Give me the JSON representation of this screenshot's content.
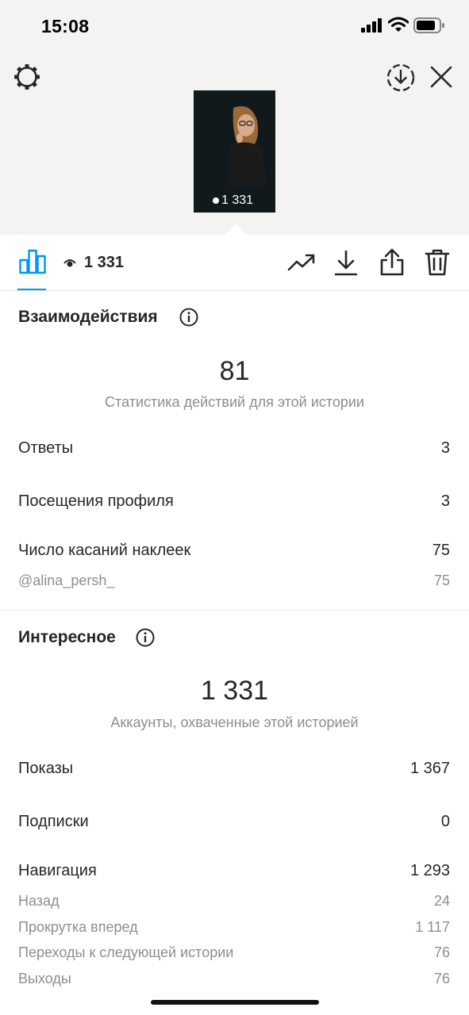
{
  "status_bar": {
    "time": "15:08"
  },
  "preview": {
    "views_overlay": "1 331"
  },
  "toolbar": {
    "views": "1 331"
  },
  "interactions": {
    "title": "Взаимодействия",
    "total": "81",
    "caption": "Статистика действий для этой истории",
    "rows": [
      {
        "label": "Ответы",
        "value": "3"
      },
      {
        "label": "Посещения профиля",
        "value": "3"
      },
      {
        "label": "Число касаний наклеек",
        "value": "75"
      }
    ],
    "sub_rows": [
      {
        "label": "@alina_persh_",
        "value": "75"
      }
    ]
  },
  "discovery": {
    "title": "Интересное",
    "total": "1 331",
    "caption": "Аккаунты, охваченные этой историей",
    "rows": [
      {
        "label": "Показы",
        "value": "1 367"
      },
      {
        "label": "Подписки",
        "value": "0"
      },
      {
        "label": "Навигация",
        "value": "1 293"
      }
    ],
    "sub_rows": [
      {
        "label": "Назад",
        "value": "24"
      },
      {
        "label": "Прокрутка вперед",
        "value": "1 117"
      },
      {
        "label": "Переходы к следующей истории",
        "value": "76"
      },
      {
        "label": "Выходы",
        "value": "76"
      }
    ]
  },
  "colors": {
    "accent": "#0095f6",
    "text": "#262626",
    "secondary": "#8e8e8e",
    "header_bg": "#f3f3f3"
  }
}
